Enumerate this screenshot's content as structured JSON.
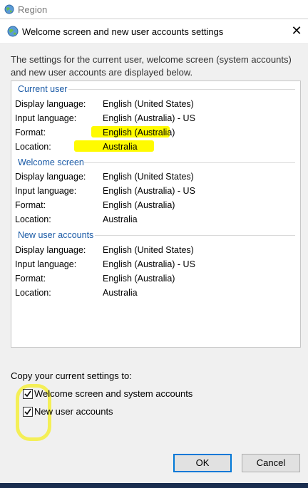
{
  "window": {
    "title": "Region",
    "icon": "globe-icon"
  },
  "dialog": {
    "title": "Welcome screen and new user accounts settings",
    "icon": "globe-icon",
    "close_label": "✕",
    "description": "The settings for the current user, welcome screen (system accounts) and new user accounts are displayed below."
  },
  "groups": [
    {
      "heading": "Current user",
      "rows": [
        {
          "label": "Display language:",
          "value": "English (United States)"
        },
        {
          "label": "Input language:",
          "value": "English (Australia) - US"
        },
        {
          "label": "Format:",
          "value": "English (Australia)"
        },
        {
          "label": "Location:",
          "value": "Australia"
        }
      ]
    },
    {
      "heading": "Welcome screen",
      "rows": [
        {
          "label": "Display language:",
          "value": "English (United States)"
        },
        {
          "label": "Input language:",
          "value": "English (Australia) - US"
        },
        {
          "label": "Format:",
          "value": "English (Australia)"
        },
        {
          "label": "Location:",
          "value": "Australia"
        }
      ]
    },
    {
      "heading": "New user accounts",
      "rows": [
        {
          "label": "Display language:",
          "value": "English (United States)"
        },
        {
          "label": "Input language:",
          "value": "English (Australia) - US"
        },
        {
          "label": "Format:",
          "value": "English (Australia)"
        },
        {
          "label": "Location:",
          "value": "Australia"
        }
      ]
    }
  ],
  "copy": {
    "label": "Copy your current settings to:",
    "options": [
      {
        "label": "Welcome screen and system accounts",
        "checked": true
      },
      {
        "label": "New user accounts",
        "checked": true
      }
    ]
  },
  "buttons": {
    "ok": "OK",
    "cancel": "Cancel"
  },
  "colors": {
    "highlight": "#fffb00",
    "heading": "#1a5aa6",
    "accent": "#0078d7"
  }
}
